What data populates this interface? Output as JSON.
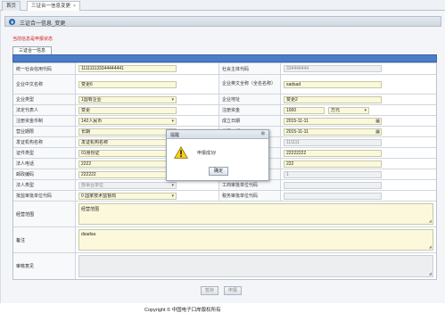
{
  "tabs": [
    {
      "label": "首页"
    },
    {
      "label": "三证合一信息变更",
      "close": "×"
    }
  ],
  "panel": {
    "title": "三证合一信息_变更"
  },
  "status_tip": "当前信息是申报状态",
  "subtab": {
    "label": "三证合一信息"
  },
  "fields": {
    "credit_code": {
      "label": "统一社会信用代码",
      "value": "111111133344444441"
    },
    "entity_code": {
      "label": "社会主体代码",
      "value": "334444444"
    },
    "cn_name": {
      "label": "企业中文名称",
      "value": "变更6"
    },
    "en_name": {
      "label": "企业英文全称（全名名称）",
      "value": "sadsad"
    },
    "type": {
      "label": "企业类型",
      "value": "1国有企业"
    },
    "address": {
      "label": "企业地址",
      "value": "变更2"
    },
    "legal_rep": {
      "label": "法定代表人",
      "value": "变更"
    },
    "capital": {
      "label": "注册资金",
      "value": "1000",
      "unit": "万元"
    },
    "currency": {
      "label": "注册资金币制",
      "value": "142人民币"
    },
    "found_date": {
      "label": "成立日期",
      "value": "2015-11-11"
    },
    "term": {
      "label": "营业期限",
      "value": "长期"
    },
    "issue_date": {
      "label": "发照日期",
      "value": "2015-11-11"
    },
    "issuer_name": {
      "label": "发证机构名称",
      "value": "发证机构名称"
    },
    "issuer_code": {
      "label": "发证机构代码",
      "value": "111111"
    },
    "id_type": {
      "label": "证件类型",
      "value": "01身份证"
    },
    "id_no": {
      "label": "证件号码",
      "value": "22222222"
    },
    "phone": {
      "label": "法人电话",
      "value": "2222"
    },
    "contact_phone": {
      "label": "联系电话",
      "value": "222"
    },
    "postcode": {
      "label": "邮政编码",
      "value": "222222"
    },
    "support_code": {
      "label": "支持机构代码",
      "value": "1"
    },
    "corp_type": {
      "label": "法人类型",
      "value": "部事业单位"
    },
    "ic_org_code": {
      "label": "工商审批单位代码",
      "value": ""
    },
    "approve_code": {
      "label": "批监审批单位代码",
      "value": "0 国家技术监督局"
    },
    "tax_org_code": {
      "label": "税务审批单位代码",
      "value": ""
    },
    "scope": {
      "label": "经营范围",
      "value": "经营范围"
    },
    "remark": {
      "label": "备注",
      "value": "dsadsa"
    },
    "review": {
      "label": "审核意见",
      "value": ""
    }
  },
  "buttons": {
    "save": "暂存",
    "submit": "申报"
  },
  "footer": {
    "copyright": "Copyright © 中国电子口岸版权所有"
  },
  "dialog": {
    "title": "提醒",
    "close": "⊠",
    "message": "申报成功!",
    "ok": "确定"
  },
  "colors": {
    "accent": "#4a7cc8",
    "field_bg": "#fbf8dc",
    "error_text": "#d02020"
  }
}
